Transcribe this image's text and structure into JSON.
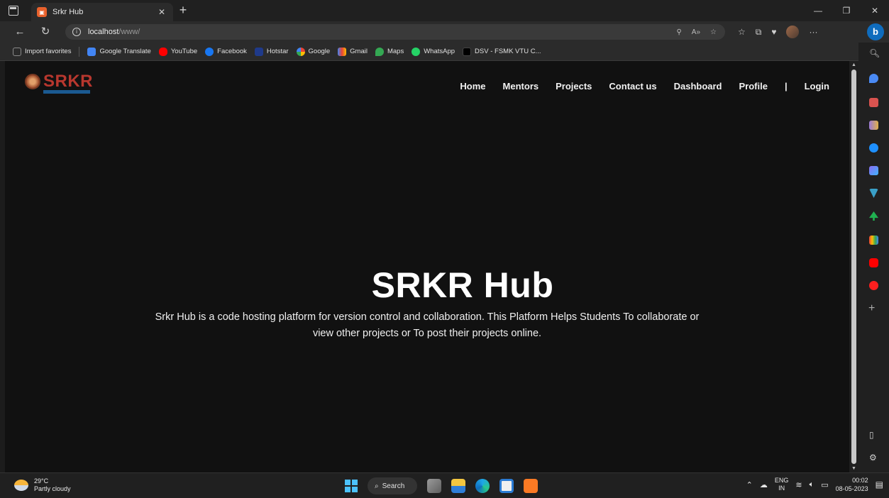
{
  "browser": {
    "tab": {
      "title": "Srkr Hub",
      "favicon": "srkr-favicon-icon"
    },
    "url": {
      "host": "localhost",
      "path": "/www/"
    },
    "favorites": [
      {
        "label": "Import favorites",
        "icon": "import-icon",
        "color": "#8a8a8a"
      },
      {
        "label": "Google Translate",
        "icon": "translate-icon",
        "color": "#4285f4"
      },
      {
        "label": "YouTube",
        "icon": "youtube-icon",
        "color": "#ff0000"
      },
      {
        "label": "Facebook",
        "icon": "facebook-icon",
        "color": "#1877f2"
      },
      {
        "label": "Hotstar",
        "icon": "hotstar-icon",
        "color": "#1f3a8a"
      },
      {
        "label": "Google",
        "icon": "google-icon",
        "color": "#ea4335"
      },
      {
        "label": "Gmail",
        "icon": "gmail-icon",
        "color": "#d93025"
      },
      {
        "label": "Maps",
        "icon": "maps-icon",
        "color": "#34a853"
      },
      {
        "label": "WhatsApp",
        "icon": "whatsapp-icon",
        "color": "#25d366"
      },
      {
        "label": "DSV - FSMK VTU C...",
        "icon": "dsv-icon",
        "color": "#111111"
      }
    ]
  },
  "site": {
    "logo_text": "SRKR",
    "nav": [
      {
        "label": "Home"
      },
      {
        "label": "Mentors"
      },
      {
        "label": "Projects"
      },
      {
        "label": "Contact us"
      },
      {
        "label": "Dashboard"
      },
      {
        "label": "Profile"
      }
    ],
    "nav_separator": "|",
    "login_label": "Login",
    "hero": {
      "title": "SRKR Hub",
      "description": "Srkr Hub is a code hosting platform for version control and collaboration. This Platform Helps Students To collaborate or view other projects or To post their projects online."
    }
  },
  "taskbar": {
    "weather": {
      "temp": "29°C",
      "condition": "Partly cloudy"
    },
    "search_label": "Search",
    "lang": {
      "line1": "ENG",
      "line2": "IN"
    },
    "clock": {
      "time": "00:02",
      "date": "08-05-2023"
    }
  },
  "colors": {
    "page_bg": "#111111",
    "logo_red": "#b8372e",
    "edge_blue": "#0f6cbd"
  }
}
